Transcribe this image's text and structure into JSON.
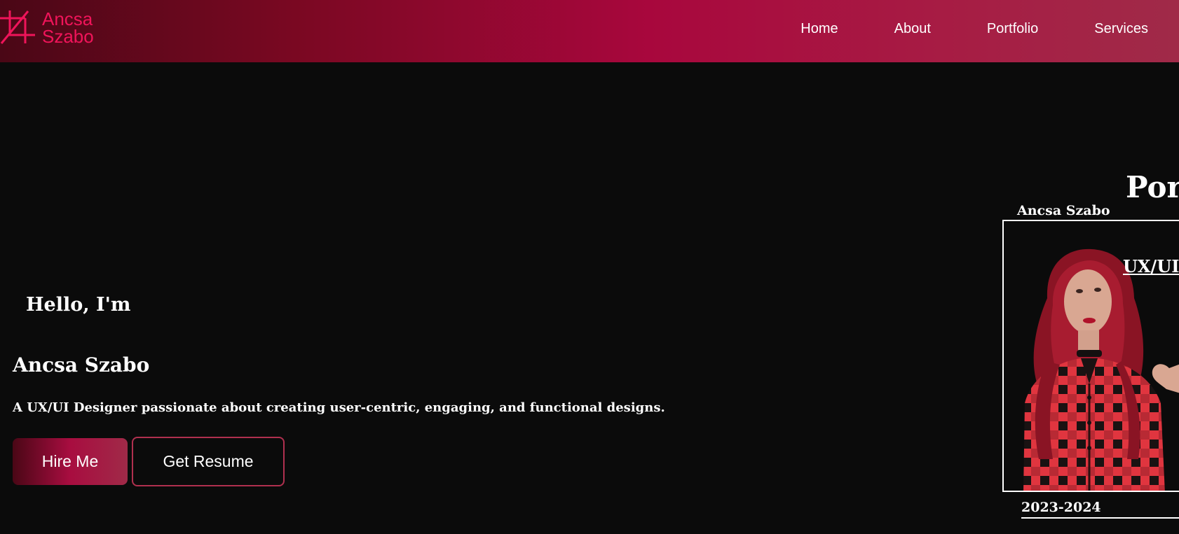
{
  "brand": {
    "logo_line1": "Ancsa",
    "logo_line2": "Szabo",
    "accent_color": "#f0145a",
    "gradient_colors": [
      "#4a0716",
      "#a8073d",
      "#a02a48"
    ]
  },
  "nav": {
    "items": [
      {
        "label": "Home"
      },
      {
        "label": "About"
      },
      {
        "label": "Portfolio"
      },
      {
        "label": "Services"
      }
    ]
  },
  "hero": {
    "greeting": "Hello, I'm",
    "name": "Ancsa Szabo",
    "tagline": "A UX/UI Designer passionate about creating user-centric, engaging, and functional designs.",
    "hire_button": "Hire Me",
    "resume_button": "Get Resume"
  },
  "portfolio_card": {
    "heading": "Por",
    "name": "Ancsa Szabo",
    "role": "UX/UI",
    "years": "2023-2024",
    "photo": "portrait-photo"
  }
}
